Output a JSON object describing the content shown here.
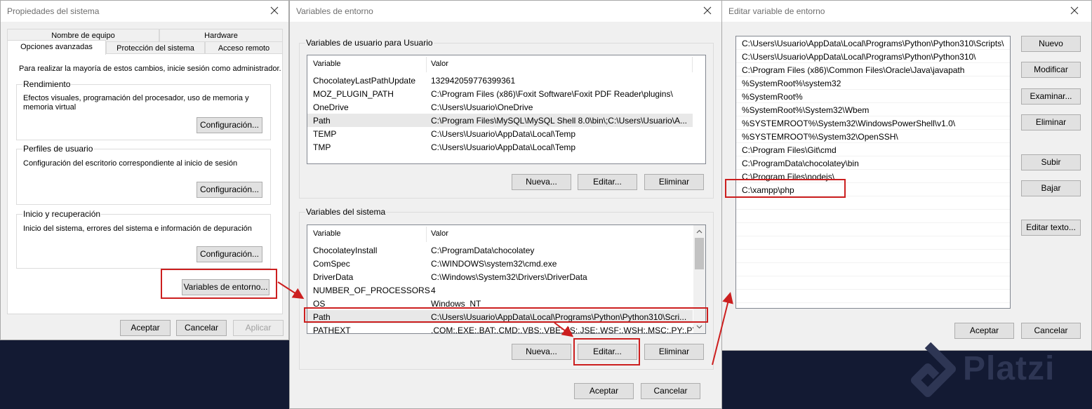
{
  "window1": {
    "title": "Propiedades del sistema",
    "tabs_back": [
      "Nombre de equipo",
      "Hardware"
    ],
    "tabs_front": [
      "Opciones avanzadas",
      "Protección del sistema",
      "Acceso remoto"
    ],
    "admin_note": "Para realizar la mayoría de estos cambios, inicie sesión como administrador.",
    "groups": [
      {
        "label": "Rendimiento",
        "desc": "Efectos visuales, programación del procesador, uso de memoria y memoria virtual",
        "button": "Configuración..."
      },
      {
        "label": "Perfiles de usuario",
        "desc": "Configuración del escritorio correspondiente al inicio de sesión",
        "button": "Configuración..."
      },
      {
        "label": "Inicio y recuperación",
        "desc": "Inicio del sistema, errores del sistema e información de depuración",
        "button": "Configuración..."
      }
    ],
    "env_button": "Variables de entorno...",
    "buttons": {
      "ok": "Aceptar",
      "cancel": "Cancelar",
      "apply": "Aplicar"
    }
  },
  "window2": {
    "title": "Variables de entorno",
    "user_group": "Variables de usuario para Usuario",
    "system_group": "Variables del sistema",
    "col_variable": "Variable",
    "col_value": "Valor",
    "user_vars": [
      {
        "name": "ChocolateyLastPathUpdate",
        "value": "132942059776399361"
      },
      {
        "name": "MOZ_PLUGIN_PATH",
        "value": "C:\\Program Files (x86)\\Foxit Software\\Foxit PDF Reader\\plugins\\"
      },
      {
        "name": "OneDrive",
        "value": "C:\\Users\\Usuario\\OneDrive"
      },
      {
        "name": "Path",
        "value": "C:\\Program Files\\MySQL\\MySQL Shell 8.0\\bin\\;C:\\Users\\Usuario\\A..."
      },
      {
        "name": "TEMP",
        "value": "C:\\Users\\Usuario\\AppData\\Local\\Temp"
      },
      {
        "name": "TMP",
        "value": "C:\\Users\\Usuario\\AppData\\Local\\Temp"
      }
    ],
    "system_vars": [
      {
        "name": "ChocolateyInstall",
        "value": "C:\\ProgramData\\chocolatey"
      },
      {
        "name": "ComSpec",
        "value": "C:\\WINDOWS\\system32\\cmd.exe"
      },
      {
        "name": "DriverData",
        "value": "C:\\Windows\\System32\\Drivers\\DriverData"
      },
      {
        "name": "NUMBER_OF_PROCESSORS",
        "value": "4"
      },
      {
        "name": "OS",
        "value": "Windows_NT"
      },
      {
        "name": "Path",
        "value": "C:\\Users\\Usuario\\AppData\\Local\\Programs\\Python\\Python310\\Scri..."
      },
      {
        "name": "PATHEXT",
        "value": ".COM;.EXE;.BAT;.CMD;.VBS;.VBE;.JS;.JSE;.WSF;.WSH;.MSC;.PY;.PYW"
      }
    ],
    "buttons": {
      "new": "Nueva...",
      "edit": "Editar...",
      "delete": "Eliminar",
      "ok": "Aceptar",
      "cancel": "Cancelar"
    }
  },
  "window3": {
    "title": "Editar variable de entorno",
    "entries": [
      "C:\\Users\\Usuario\\AppData\\Local\\Programs\\Python\\Python310\\Scripts\\",
      "C:\\Users\\Usuario\\AppData\\Local\\Programs\\Python\\Python310\\",
      "C:\\Program Files (x86)\\Common Files\\Oracle\\Java\\javapath",
      "%SystemRoot%\\system32",
      "%SystemRoot%",
      "%SystemRoot%\\System32\\Wbem",
      "%SYSTEMROOT%\\System32\\WindowsPowerShell\\v1.0\\",
      "%SYSTEMROOT%\\System32\\OpenSSH\\",
      "C:\\Program Files\\Git\\cmd",
      "C:\\ProgramData\\chocolatey\\bin",
      "C:\\Program Files\\nodejs\\",
      "C:\\xampp\\php"
    ],
    "buttons": {
      "new": "Nuevo",
      "modify": "Modificar",
      "browse": "Examinar...",
      "delete": "Eliminar",
      "up": "Subir",
      "down": "Bajar",
      "edit_text": "Editar texto...",
      "ok": "Aceptar",
      "cancel": "Cancelar"
    }
  },
  "watermark": "Platzi",
  "colors": {
    "highlight": "#cc1f1f",
    "background": "#131a33",
    "dialog": "#f0f0f0"
  }
}
